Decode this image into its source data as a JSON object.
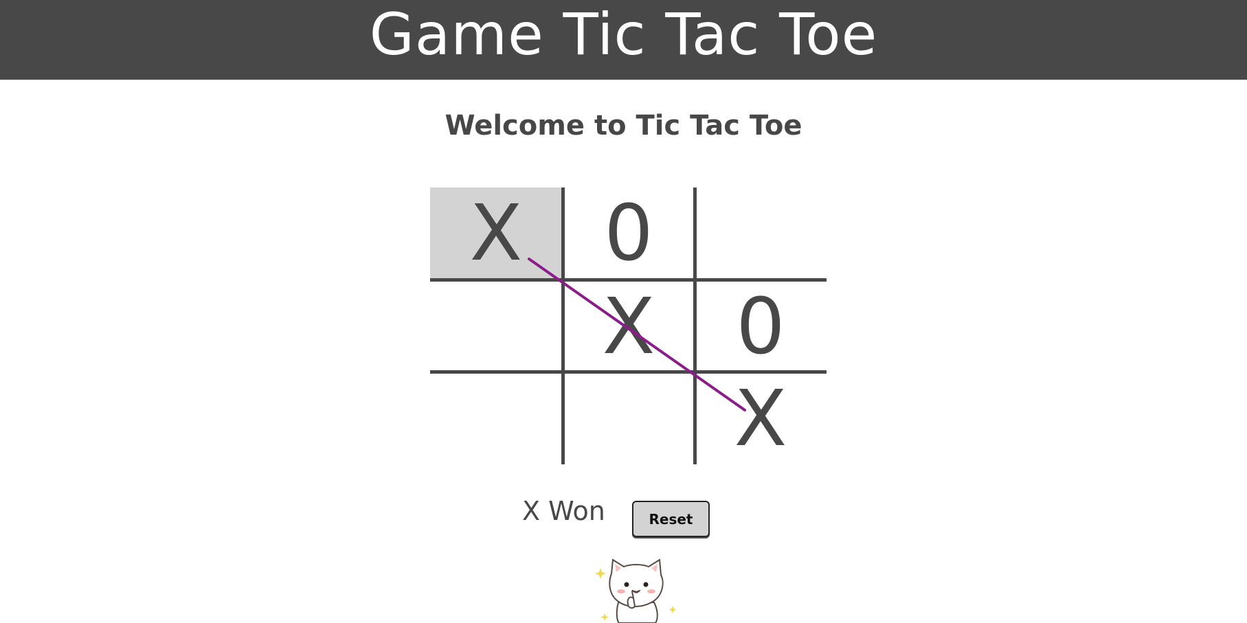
{
  "header": {
    "title": "Game Tic Tac Toe",
    "background": "#484848"
  },
  "welcome_text": "Welcome to Tic Tac Toe",
  "board": {
    "cells": [
      "X",
      "0",
      "",
      "",
      "X",
      "0",
      "",
      "",
      "X"
    ],
    "highlighted_cell": 0,
    "winning_line": [
      0,
      4,
      8
    ],
    "win_line_color": "#8b1d8b"
  },
  "status": {
    "text": "X Won"
  },
  "controls": {
    "reset_label": "Reset"
  },
  "mascot": {
    "icon": "cat-mascot-icon"
  }
}
